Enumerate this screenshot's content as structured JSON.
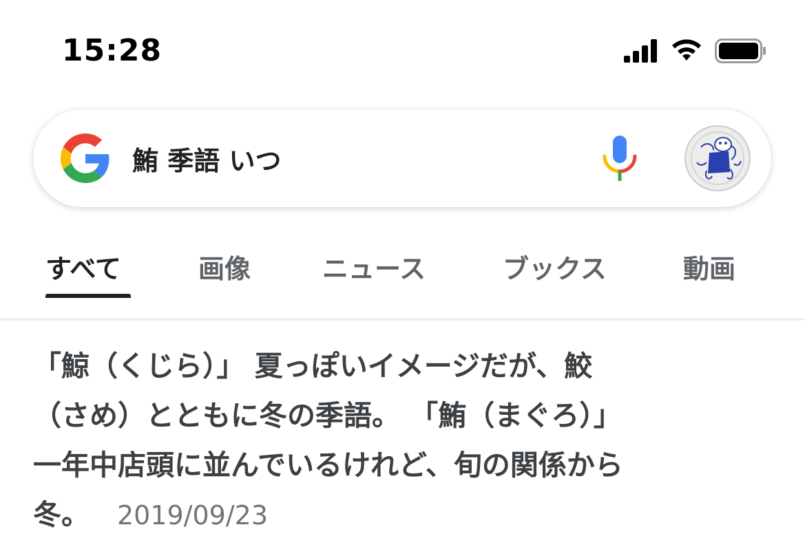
{
  "status_bar": {
    "time": "15:28",
    "icons": [
      "cellular-signal-icon",
      "wifi-icon",
      "battery-icon"
    ]
  },
  "search": {
    "query": "鮪 季語 いつ",
    "logo": "google-g-icon",
    "voice_icon": "microphone-icon",
    "avatar": "profile-avatar"
  },
  "tabs": [
    {
      "label": "すべて",
      "active": true
    },
    {
      "label": "画像",
      "active": false
    },
    {
      "label": "ニュース",
      "active": false
    },
    {
      "label": "ブックス",
      "active": false
    },
    {
      "label": "動画",
      "active": false
    }
  ],
  "snippet": {
    "lines": [
      "「鯨（くじら）」 夏っぽいイメージだが、鮫",
      "（さめ）とともに冬の季語。 「鮪（まぐろ）」",
      "一年中店頭に並んでいるけれど、旬の関係から",
      "冬。"
    ],
    "date": "2019/09/23"
  },
  "colors": {
    "google_blue": "#4285F4",
    "google_red": "#EA4335",
    "google_yellow": "#FBBC05",
    "google_green": "#34A853",
    "text_primary": "#202124",
    "text_secondary": "#5f6368"
  }
}
